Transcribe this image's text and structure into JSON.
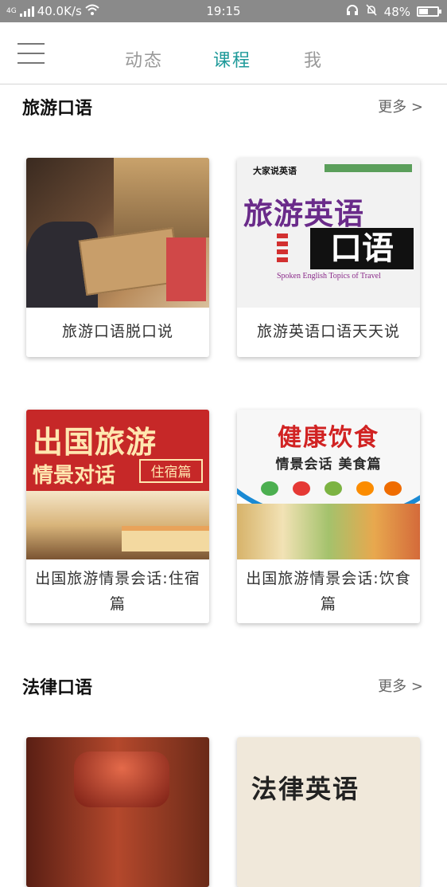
{
  "status_bar": {
    "network": "4G",
    "speed": "40.0K/s",
    "time": "19:15",
    "battery": "48%",
    "battery_level": 0.48
  },
  "nav": {
    "tabs": [
      {
        "label": "动态",
        "active": false
      },
      {
        "label": "课程",
        "active": true
      },
      {
        "label": "我",
        "active": false
      }
    ],
    "accent_color": "#1f9a9a"
  },
  "sections": [
    {
      "title": "旅游口语",
      "more": "更多 >",
      "cards": [
        {
          "caption": "旅游口语脱口说"
        },
        {
          "caption": "旅游英语口语天天说",
          "cover": {
            "header": "大家说英语",
            "title": "旅游英语",
            "subtitle": "口语",
            "english": "Spoken English Topics of Travel"
          }
        },
        {
          "caption": "出国旅游情景会话:住宿篇",
          "cover": {
            "title": "出国旅游",
            "subtitle": "情景对话",
            "tag": "住宿篇"
          }
        },
        {
          "caption": "出国旅游情景会话:饮食篇",
          "cover": {
            "title": "健康饮食",
            "subtitle": "情景会话  美食篇"
          }
        }
      ]
    },
    {
      "title": "法律口语",
      "more": "更多 >",
      "cards": [
        {
          "caption": ""
        },
        {
          "caption": "",
          "cover": {
            "title": "法律英语"
          }
        }
      ]
    }
  ]
}
